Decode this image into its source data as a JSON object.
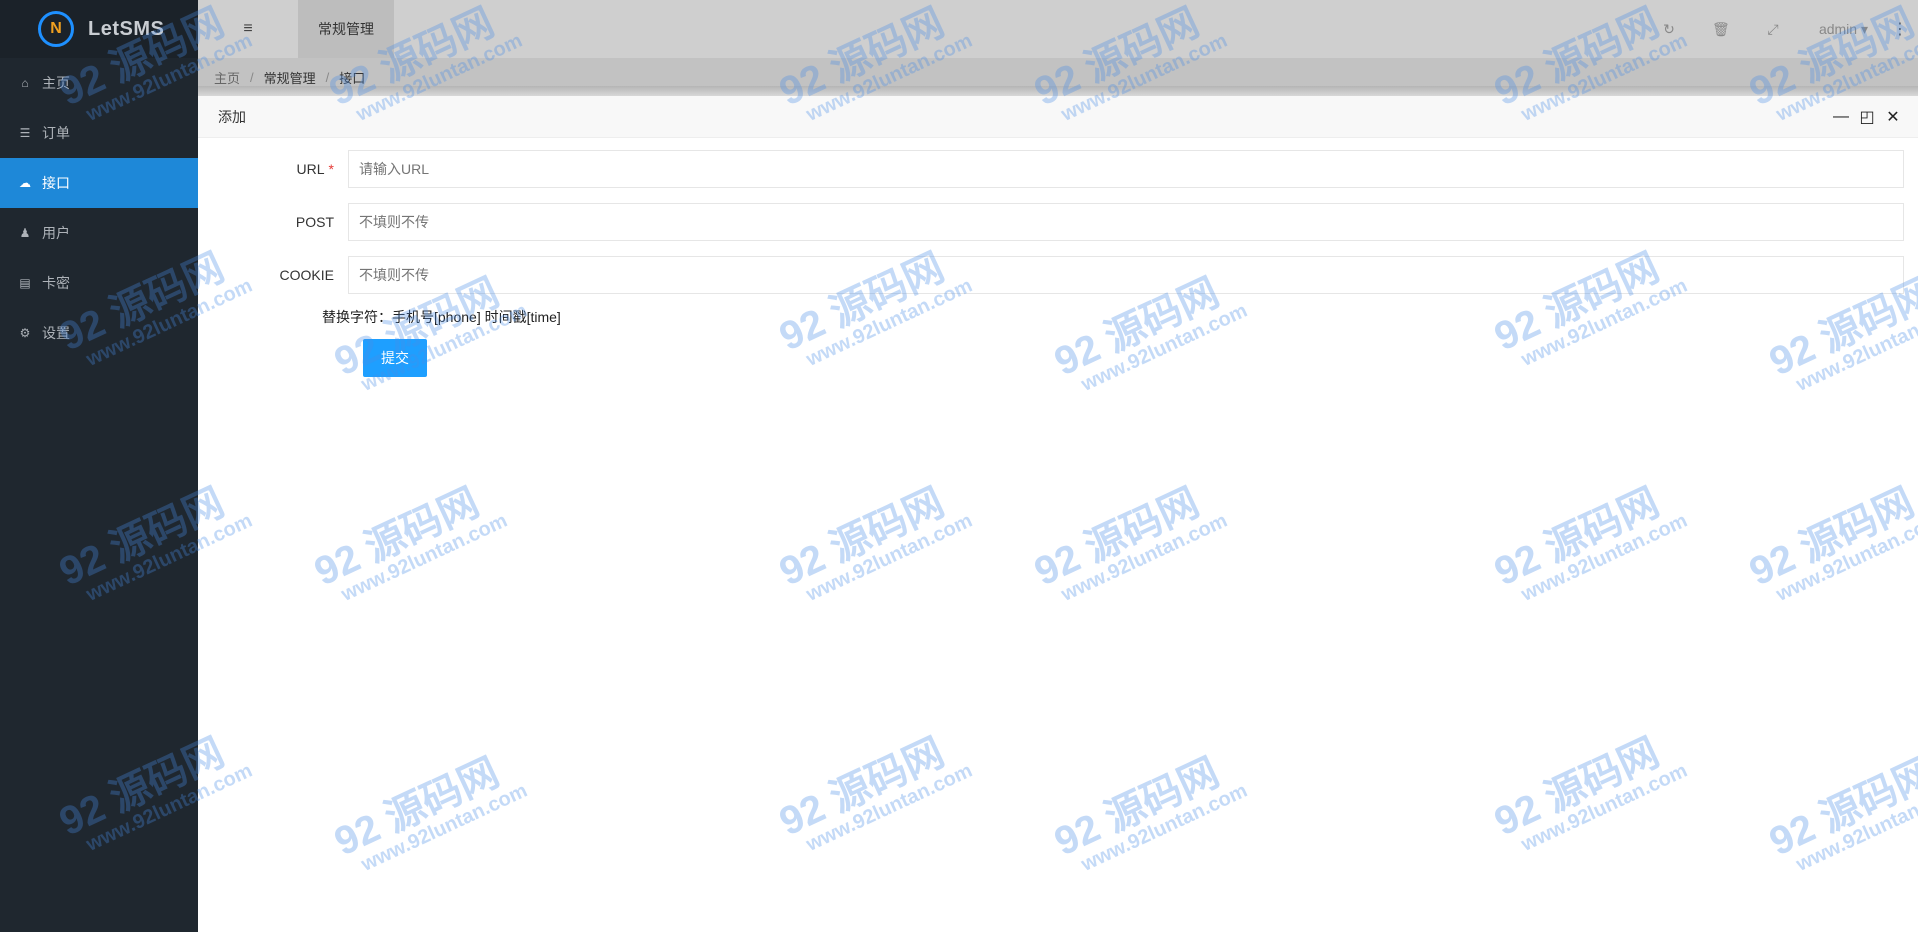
{
  "app": {
    "logo_glyph": "N",
    "name": "LetSMS"
  },
  "sidebar": {
    "items": [
      {
        "icon": "home-icon",
        "glyph": "⌂",
        "label": "主页",
        "active": false
      },
      {
        "icon": "list-icon",
        "glyph": "☰",
        "label": "订单",
        "active": false
      },
      {
        "icon": "cloud-icon",
        "glyph": "☁",
        "label": "接口",
        "active": true
      },
      {
        "icon": "users-icon",
        "glyph": "♟",
        "label": "用户",
        "active": false
      },
      {
        "icon": "card-icon",
        "glyph": "▤",
        "label": "卡密",
        "active": false
      },
      {
        "icon": "gear-icon",
        "glyph": "⚙",
        "label": "设置",
        "active": false
      }
    ]
  },
  "header": {
    "menu_toggle_glyph": "≡",
    "tab_label": "常规管理",
    "refresh_glyph": "↻",
    "trash_glyph": "🗑",
    "fullscreen_glyph": "⤢",
    "user": "admin ▾",
    "more_glyph": "⋮"
  },
  "breadcrumb": {
    "home": "主页",
    "section": "常规管理",
    "current": "接口",
    "separator": "/"
  },
  "modal": {
    "title": "添加",
    "minimize_glyph": "—",
    "maximize_glyph": "◰",
    "close_glyph": "✕",
    "fields": {
      "url": {
        "label": "URL",
        "required_mark": "*",
        "placeholder": "请输入URL",
        "value": ""
      },
      "post": {
        "label": "POST",
        "placeholder": "不填则不传",
        "value": ""
      },
      "cookie": {
        "label": "COOKIE",
        "placeholder": "不填则不传",
        "value": ""
      }
    },
    "hint": "替换字符：手机号[phone] 时间戳[time]",
    "submit_label": "提交"
  },
  "watermark": {
    "big": "92 源码网",
    "small": "www.92luntan.com"
  },
  "colors": {
    "sidebar_bg": "#1f272f",
    "active_item": "#1e88d8",
    "primary_button": "#1e9fff",
    "required": "#e53935"
  }
}
